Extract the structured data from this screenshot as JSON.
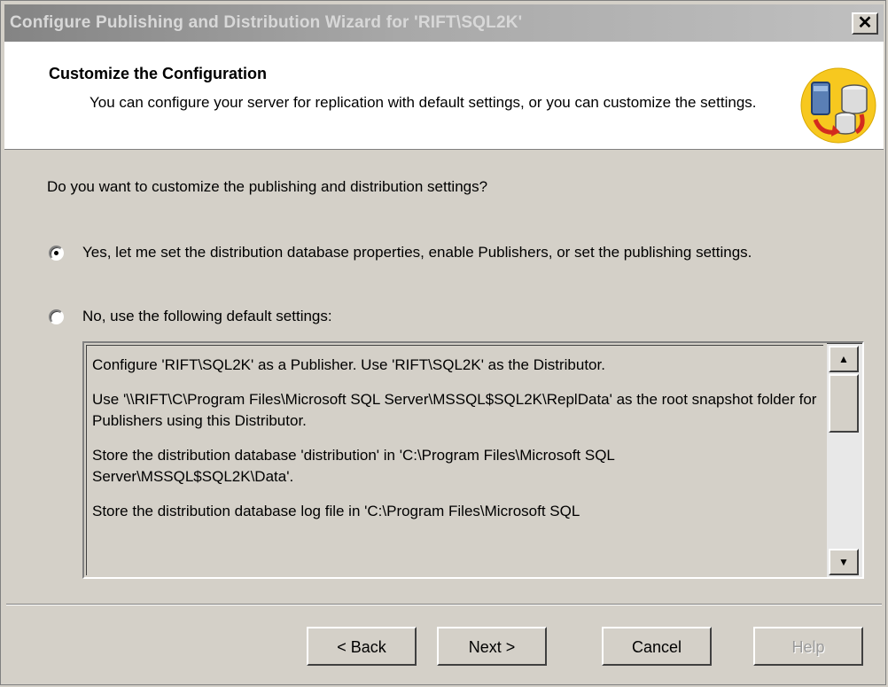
{
  "window": {
    "title": "Configure Publishing and Distribution Wizard for 'RIFT\\SQL2K'",
    "close_label": "✕"
  },
  "header": {
    "title": "Customize the Configuration",
    "description": "You can configure your server for replication with default settings, or you can customize the settings.",
    "icon": "replication-databases-icon"
  },
  "question": "Do you want to customize the publishing and distribution settings?",
  "options": [
    {
      "label": "Yes, let me set the distribution database properties, enable Publishers, or set the publishing settings.",
      "selected": true
    },
    {
      "label": "No, use the following default settings:",
      "selected": false
    }
  ],
  "default_settings": [
    "Configure 'RIFT\\SQL2K' as a Publisher. Use 'RIFT\\SQL2K' as the Distributor.",
    "Use '\\\\RIFT\\C\\Program Files\\Microsoft SQL Server\\MSSQL$SQL2K\\ReplData' as the root snapshot folder for Publishers using this Distributor.",
    "Store the distribution database 'distribution' in 'C:\\Program Files\\Microsoft SQL Server\\MSSQL$SQL2K\\Data'.",
    "Store the distribution database log file in 'C:\\Program Files\\Microsoft SQL"
  ],
  "scrollbar": {
    "up_glyph": "▲",
    "down_glyph": "▼"
  },
  "buttons": {
    "back": "< Back",
    "next": "Next >",
    "cancel": "Cancel",
    "help": "Help"
  },
  "colors": {
    "face": "#d4d0c8",
    "header_bg": "#ffffff",
    "icon_circle": "#f7c81f"
  }
}
